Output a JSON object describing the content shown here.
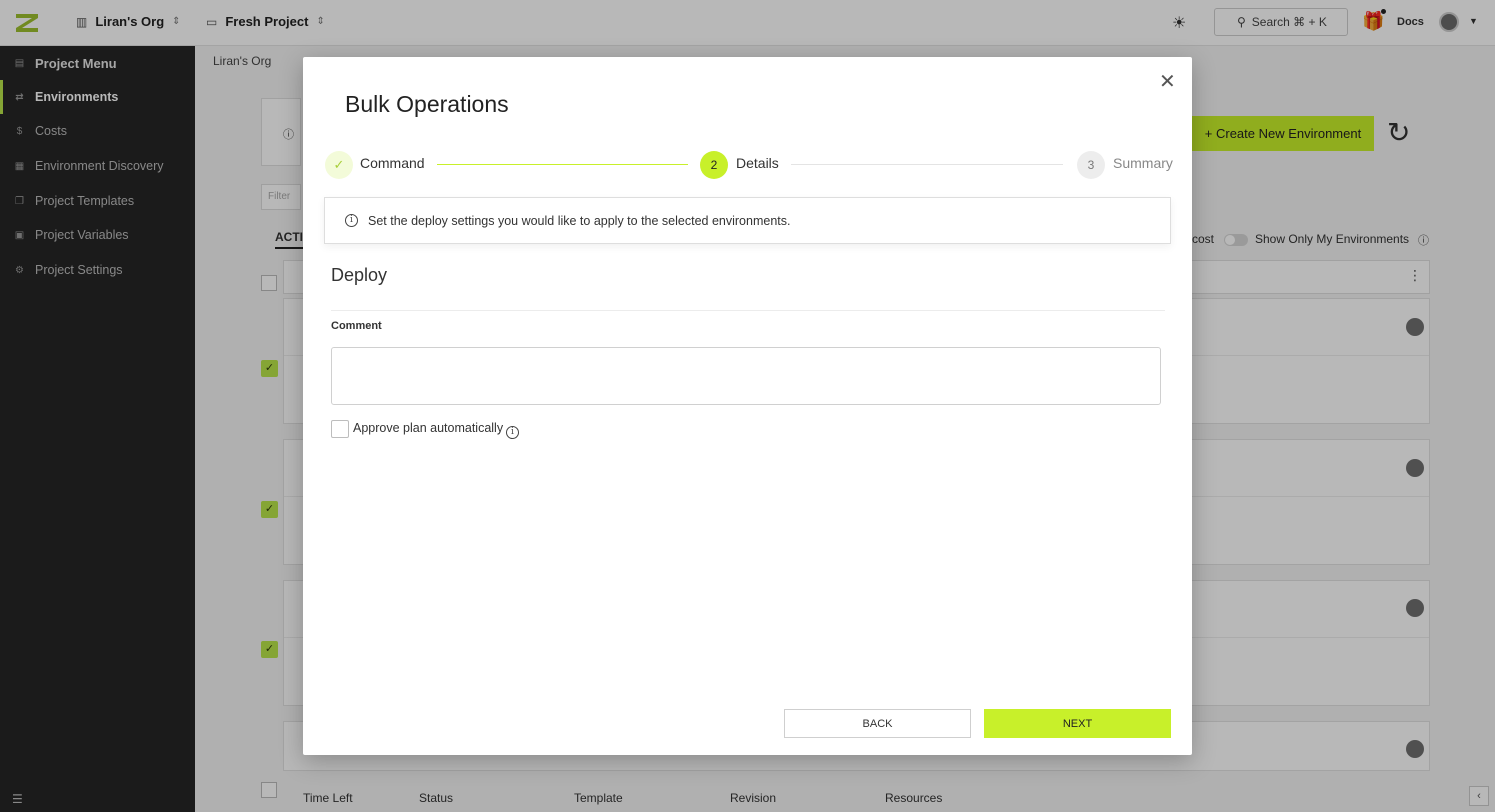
{
  "topbar": {
    "org": "Liran's Org",
    "project": "Fresh Project",
    "search_label": "Search ⌘ + K",
    "docs": "Docs"
  },
  "sidebar": {
    "items": [
      {
        "label": "Project Menu",
        "icon": "menu-icon"
      },
      {
        "label": "Environments",
        "icon": "environments-icon"
      },
      {
        "label": "Costs",
        "icon": "dollar-icon"
      },
      {
        "label": "Environment Discovery",
        "icon": "discovery-icon"
      },
      {
        "label": "Project Templates",
        "icon": "templates-icon"
      },
      {
        "label": "Project Variables",
        "icon": "variables-icon"
      },
      {
        "label": "Project Settings",
        "icon": "gear-icon"
      }
    ]
  },
  "main": {
    "breadcrumb": "Liran's Org",
    "create_button": "+ Create New Environment",
    "filter_placeholder": "Filter",
    "tab_active": "ACTI",
    "cost_label": "cost",
    "show_only_mine": "Show Only My Environments",
    "columns": [
      "Time Left",
      "Status",
      "Template",
      "Revision",
      "Resources"
    ]
  },
  "modal": {
    "title": "Bulk Operations",
    "steps": [
      {
        "number": "✓",
        "label": "Command",
        "state": "done"
      },
      {
        "number": "2",
        "label": "Details",
        "state": "current"
      },
      {
        "number": "3",
        "label": "Summary",
        "state": "todo"
      }
    ],
    "info_text": "Set the deploy settings you would like to apply to the selected environments.",
    "section_title": "Deploy",
    "comment_label": "Comment",
    "comment_value": "",
    "approve_label": "Approve plan automatically",
    "approve_checked": false,
    "back_label": "BACK",
    "next_label": "NEXT"
  },
  "colors": {
    "accent": "#c8f02a",
    "sidebar_bg": "#262626"
  }
}
